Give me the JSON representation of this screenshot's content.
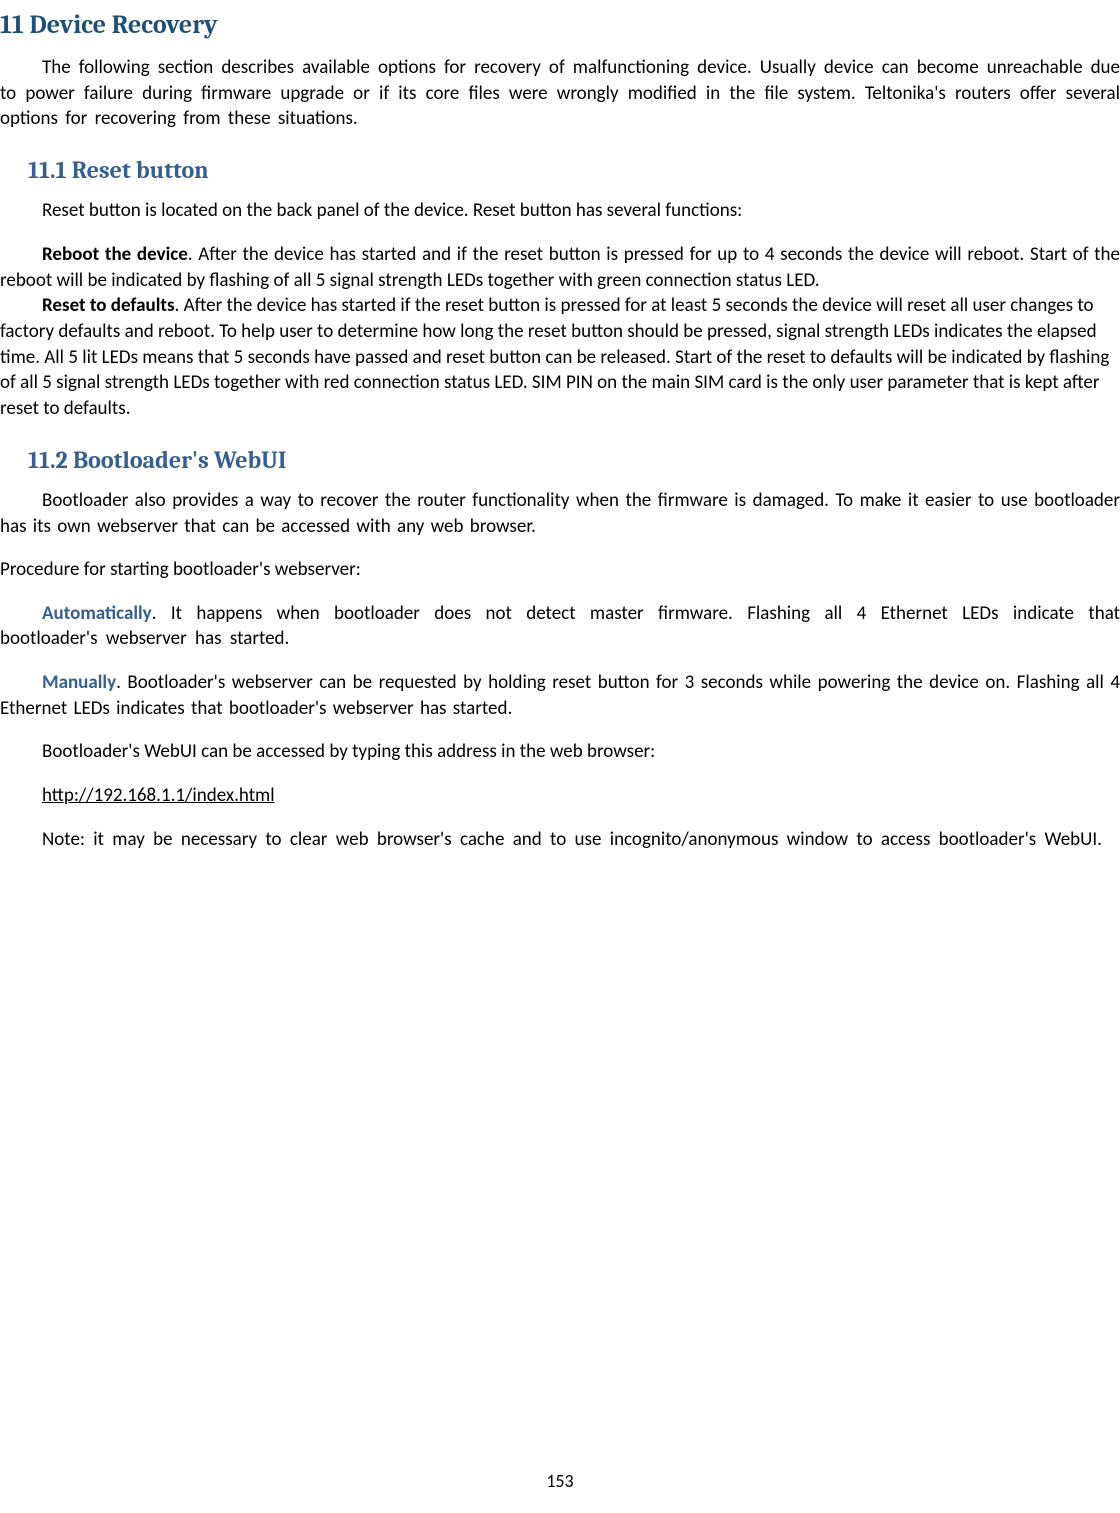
{
  "headings": {
    "h1": "11 Device Recovery",
    "h2_1": "11.1 Reset button",
    "h2_2": "11.2 Bootloader's WebUI"
  },
  "paragraphs": {
    "intro": "The following section describes available options for recovery of malfunctioning device. Usually device can become unreachable due to power failure during firmware upgrade or if its core files were wrongly modified in the file system. Teltonika's routers offer several options for recovering from these situations.",
    "reset_intro": "Reset button is located on the back panel of the device. Reset button has several functions:",
    "reboot_bold": "Reboot the device",
    "reboot_text": ". After the device has started and if the reset button is pressed for up to 4 seconds the device will reboot. Start of the reboot will be indicated by flashing of all 5 signal strength LEDs together with green connection status LED.",
    "reset_bold": "Reset to defaults",
    "reset_text": ". After the device has started if the reset button is pressed for at least 5 seconds the device will reset all user changes to factory defaults and reboot. To help user to determine how long the reset button should be pressed, signal strength LEDs indicates the elapsed time. All 5 lit LEDs means that 5 seconds have passed and reset button can be released. Start of the reset to defaults will be indicated by flashing of all 5 signal strength LEDs together with red connection status LED. SIM PIN on the main SIM card is the only user parameter that is kept after reset to defaults.",
    "bootloader_intro": "Bootloader also provides a way to recover the router functionality when the firmware is damaged. To make it easier to use bootloader has its own webserver that can be accessed with any web browser.",
    "procedure_intro": "Procedure for starting bootloader's webserver:",
    "auto_bold": "Automatically",
    "auto_text": ". It happens when bootloader does not detect master firmware. Flashing all 4 Ethernet LEDs indicate that bootloader's webserver has started.",
    "manual_bold": "Manually",
    "manual_text": ". Bootloader's webserver can be requested by holding reset button for 3 seconds while powering the device on. Flashing all 4 Ethernet LEDs indicates that bootloader's webserver has started.",
    "access_text": "Bootloader's WebUI can be accessed by typing this address in the web browser:",
    "link_text": "http://192.168.1.1/index.html",
    "note_text": "Note: it may be necessary to clear web browser's cache and to use incognito/anonymous window to access bootloader's WebUI."
  },
  "page_number": "153"
}
